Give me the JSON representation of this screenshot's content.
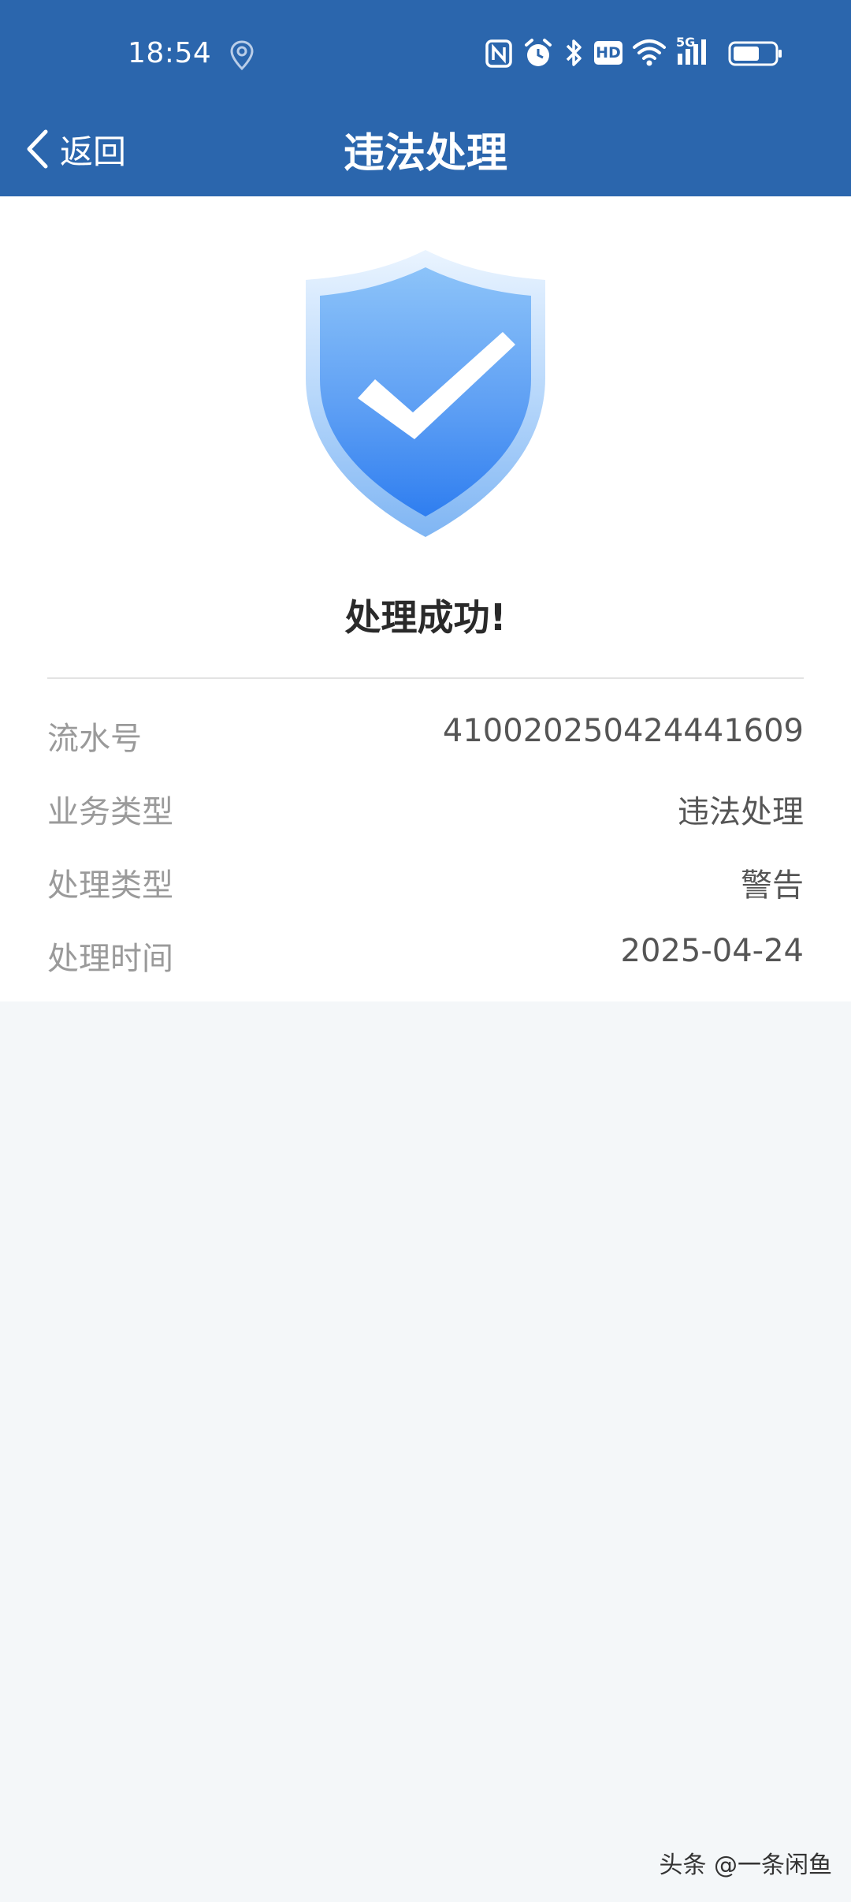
{
  "status_bar": {
    "time": "18:54",
    "icons": [
      "location-icon",
      "nfc-icon",
      "alarm-icon",
      "bluetooth-icon",
      "hd-icon",
      "wifi-icon",
      "signal-5g-icon",
      "battery-icon"
    ],
    "hd_label": "HD",
    "network_label": "5G"
  },
  "nav": {
    "back_label": "返回",
    "title": "违法处理"
  },
  "result": {
    "title": "处理成功!"
  },
  "details": [
    {
      "label": "流水号",
      "value": "41002025042444160​9"
    },
    {
      "label": "业务类型",
      "value": "违法处理"
    },
    {
      "label": "处理类型",
      "value": "警告"
    },
    {
      "label": "处理时间",
      "value": "2025-04-24"
    }
  ],
  "watermark": "头条 @一条闲鱼",
  "colors": {
    "header_bg": "#2b66ad",
    "page_bg": "#f4f7f9",
    "card_bg": "#ffffff",
    "shield_blue": "#3a8af0"
  }
}
